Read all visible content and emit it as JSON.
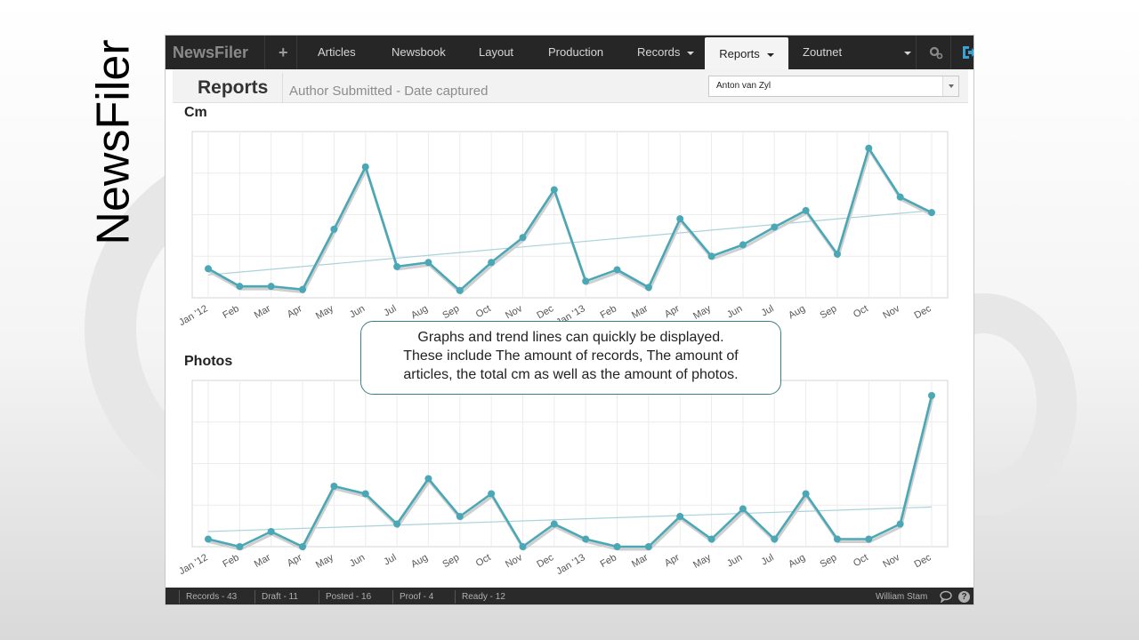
{
  "slide": {
    "title": "NewsFiler"
  },
  "navbar": {
    "brand": "NewsFiler",
    "plus_label": "+",
    "items": [
      {
        "label": "Articles"
      },
      {
        "label": "Newsbook"
      },
      {
        "label": "Layout"
      },
      {
        "label": "Production"
      },
      {
        "label": "Records"
      },
      {
        "label": "Reports"
      },
      {
        "label": "Zoutnet"
      }
    ],
    "active_item": "Reports",
    "icons": [
      "gear-icon",
      "logout-icon"
    ]
  },
  "subheader": {
    "title": "Reports",
    "description": "Author Submitted - Date captured",
    "author_select": {
      "selected": "Anton van Zyl"
    }
  },
  "callout": {
    "line1": "Graphs and trend lines can quickly be displayed.",
    "line2": "These include The amount of records, The amount of",
    "line3": "articles, the total cm as well as the amount of photos."
  },
  "chart_data": [
    {
      "type": "line",
      "title": "Cm",
      "categories": [
        "Jan '12",
        "Feb",
        "Mar",
        "Apr",
        "May",
        "Jun",
        "Jul",
        "Aug",
        "Sep",
        "Oct",
        "Nov",
        "Dec",
        "Jan '13",
        "Feb",
        "Mar",
        "Apr",
        "May",
        "Jun",
        "Jul",
        "Aug",
        "Sep",
        "Oct",
        "Nov",
        "Dec"
      ],
      "series": [
        {
          "values": [
            14,
            5.5,
            5.5,
            4,
            33,
            63,
            15,
            17,
            3.5,
            17,
            29,
            52,
            8,
            13.5,
            5,
            38,
            20,
            25.5,
            34,
            42,
            21,
            72,
            48.5,
            41
          ]
        }
      ],
      "trendline": {
        "start": 11,
        "end": 42
      },
      "ylim": [
        0,
        80
      ],
      "grid": true,
      "color": "#4aa8b6",
      "trend_color": "#a9d3da"
    },
    {
      "type": "line",
      "title": "Photos",
      "categories": [
        "Jan '12",
        "Feb",
        "Mar",
        "Apr",
        "May",
        "Jun",
        "Jul",
        "Aug",
        "Sep",
        "Oct",
        "Nov",
        "Dec",
        "Jan '13",
        "Feb",
        "Mar",
        "Apr",
        "May",
        "Jun",
        "Jul",
        "Aug",
        "Sep",
        "Oct",
        "Nov",
        "Dec"
      ],
      "series": [
        {
          "values": [
            2,
            0,
            4,
            0,
            16,
            14,
            6,
            18,
            8,
            14,
            0,
            6,
            2,
            0,
            0,
            8,
            2,
            10,
            2,
            14,
            2,
            2,
            6,
            40
          ]
        }
      ],
      "trendline": {
        "start": 4,
        "end": 10.5
      },
      "ylim": [
        0,
        44
      ],
      "grid": true,
      "color": "#4aa8b6",
      "trend_color": "#a9d3da"
    }
  ],
  "statusbar": {
    "records": "Records - 43",
    "draft": "Draft - 11",
    "posted": "Posted - 16",
    "proof": "Proof - 4",
    "ready": "Ready - 12",
    "user": "William Stam",
    "icons": [
      "chat-icon",
      "help-icon"
    ],
    "help_glyph": "?"
  }
}
